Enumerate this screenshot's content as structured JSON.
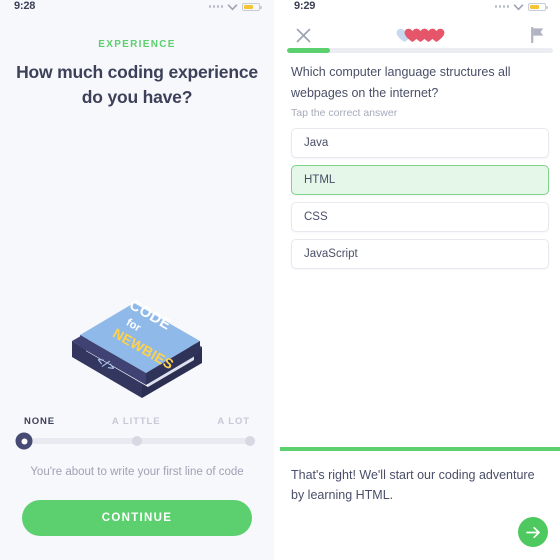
{
  "left_screen": {
    "status_bar": {
      "clock": "9:28",
      "signal_icon": "signal-dots-icon",
      "wifi_icon": "wifi-icon",
      "battery_icon": "battery-low-icon"
    },
    "eyebrow": "EXPERIENCE",
    "headline": "How much coding experience do you have?",
    "illustration": {
      "name": "code-for-newbies-book-illustration",
      "title_line1": "CODE",
      "title_line2": "for",
      "title_line3": "NEWBIES",
      "spine_glyph": "</>",
      "cover_color": "#8fb9e8",
      "spine_color": "#3f4272",
      "accent_color": "#ffd24d"
    },
    "slider": {
      "labels": [
        "NONE",
        "A LITTLE",
        "A LOT"
      ],
      "selected_index": 0,
      "selected_label": "NONE",
      "knob_color": "#474b73",
      "track_color": "#e9eaf1"
    },
    "hint": "You're about to write your first line of code",
    "continue_label": "CONTINUE",
    "accent_green": "#5ccf6e"
  },
  "right_screen": {
    "status_bar": {
      "clock": "9:29",
      "signal_icon": "signal-dots-icon",
      "wifi_icon": "wifi-icon",
      "battery_icon": "battery-low-icon"
    },
    "header": {
      "close_icon": "close-icon",
      "flag_icon": "flag-icon",
      "hearts_total": 5,
      "hearts_filled": 4,
      "heart_full_color": "#e5566b",
      "heart_empty_color": "#c8d8ef"
    },
    "progress": {
      "percent": 16,
      "fill_color": "#5ccf6e",
      "track_color": "#ebedf2"
    },
    "question": "Which computer language structures all webpages on the internet?",
    "sub_hint": "Tap the correct answer",
    "options": [
      {
        "label": "Java",
        "selected": false
      },
      {
        "label": "HTML",
        "selected": true
      },
      {
        "label": "CSS",
        "selected": false
      },
      {
        "label": "JavaScript",
        "selected": false
      }
    ],
    "feedback": {
      "text": "That's right! We'll start our coding adventure by learning HTML.",
      "border_color": "#5ccf6e",
      "next_icon": "arrow-right-icon",
      "next_button_color": "#4ec95f"
    }
  }
}
